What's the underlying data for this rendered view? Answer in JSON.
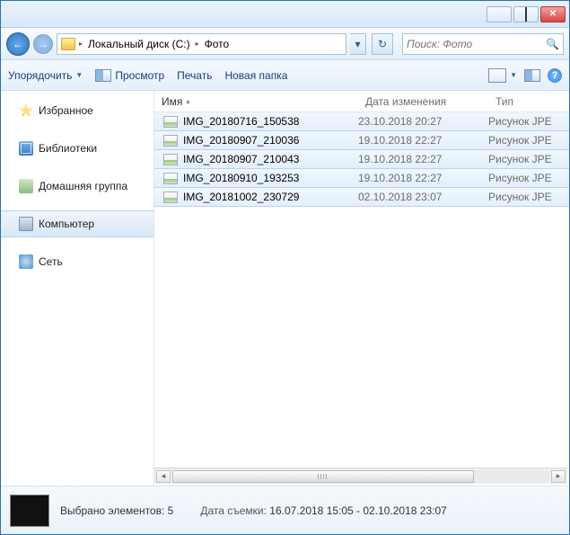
{
  "breadcrumbs": {
    "drive": "Локальный диск (C:)",
    "folder": "Фото"
  },
  "search": {
    "placeholder": "Поиск: Фото"
  },
  "toolbar": {
    "organize": "Упорядочить",
    "preview": "Просмотр",
    "print": "Печать",
    "new_folder": "Новая папка"
  },
  "sidebar": {
    "favorites": "Избранное",
    "libraries": "Библиотеки",
    "homegroup": "Домашняя группа",
    "computer": "Компьютер",
    "network": "Сеть"
  },
  "columns": {
    "name": "Имя",
    "date": "Дата изменения",
    "type": "Тип"
  },
  "files": [
    {
      "name": "IMG_20180716_150538",
      "date": "23.10.2018 20:27",
      "type": "Рисунок JPE"
    },
    {
      "name": "IMG_20180907_210036",
      "date": "19.10.2018 22:27",
      "type": "Рисунок JPE"
    },
    {
      "name": "IMG_20180907_210043",
      "date": "19.10.2018 22:27",
      "type": "Рисунок JPE"
    },
    {
      "name": "IMG_20180910_193253",
      "date": "19.10.2018 22:27",
      "type": "Рисунок JPE"
    },
    {
      "name": "IMG_20181002_230729",
      "date": "02.10.2018 23:07",
      "type": "Рисунок JPE"
    }
  ],
  "details": {
    "selection": "Выбрано элементов: 5",
    "shot_label": "Дата съемки:",
    "shot_value": "16.07.2018 15:05 - 02.10.2018 23:07"
  }
}
